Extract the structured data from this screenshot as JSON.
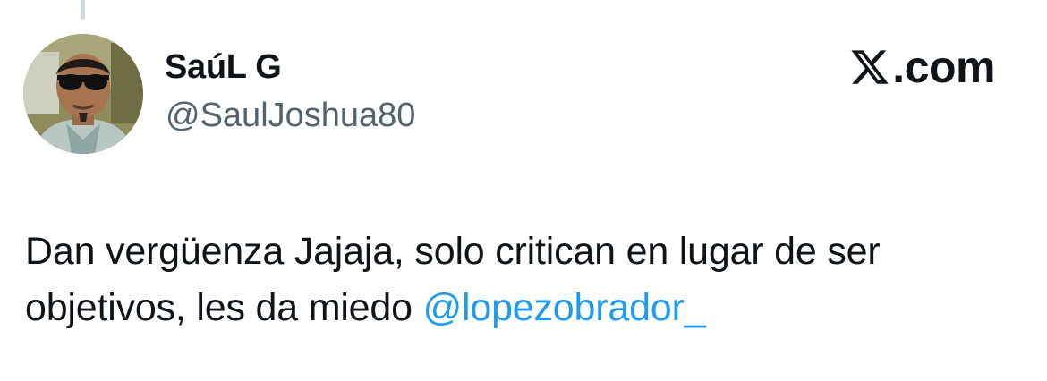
{
  "author": {
    "display_name": "SaúL G",
    "handle": "@SaulJoshua80"
  },
  "brand": {
    "logo_icon": "x-logo-icon",
    "text": ".com"
  },
  "tweet": {
    "text": "Dan vergüenza Jajaja, solo critican en lugar de ser objetivos, les da miedo ",
    "mention": "@lopezobrador_"
  },
  "colors": {
    "mention": "#1d9bf0",
    "handle": "#536471",
    "text": "#0f1419",
    "thread_line": "#cfd9de"
  }
}
